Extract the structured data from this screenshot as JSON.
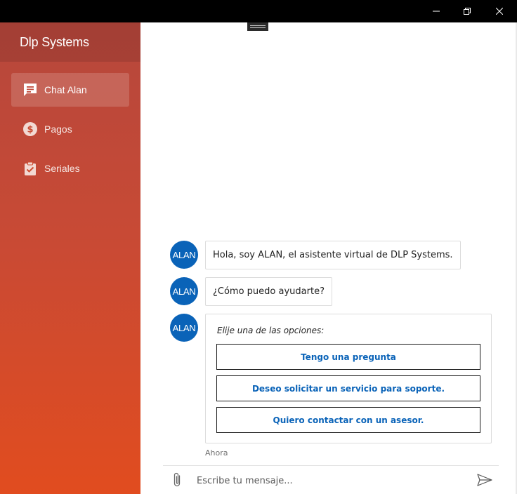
{
  "sidebar": {
    "brand": "Dlp Systems",
    "items": [
      {
        "label": "Chat Alan",
        "icon": "chat-icon",
        "active": true
      },
      {
        "label": "Pagos",
        "icon": "dollar-icon",
        "active": false
      },
      {
        "label": "Seriales",
        "icon": "clipboard-check-icon",
        "active": false
      }
    ]
  },
  "chat": {
    "messages": [
      {
        "sender": "ALAN",
        "text": "Hola, soy ALAN, el asistente virtual de DLP Systems."
      },
      {
        "sender": "ALAN",
        "text": "¿Cómo puedo ayudarte?"
      }
    ],
    "options_card": {
      "sender": "ALAN",
      "prompt": "Elije una de las opciones:",
      "options": [
        "Tengo una pregunta",
        "Deseo solicitar un servicio para soporte.",
        "Quiero contactar con un asesor."
      ]
    },
    "timestamp": "Ahora"
  },
  "composer": {
    "placeholder": "Escribe tu mensaje..."
  },
  "colors": {
    "accent_blue": "#0a63b8",
    "sidebar_top": "#b6473c",
    "sidebar_bottom": "#e14c1f",
    "titlebar": "#000000"
  }
}
